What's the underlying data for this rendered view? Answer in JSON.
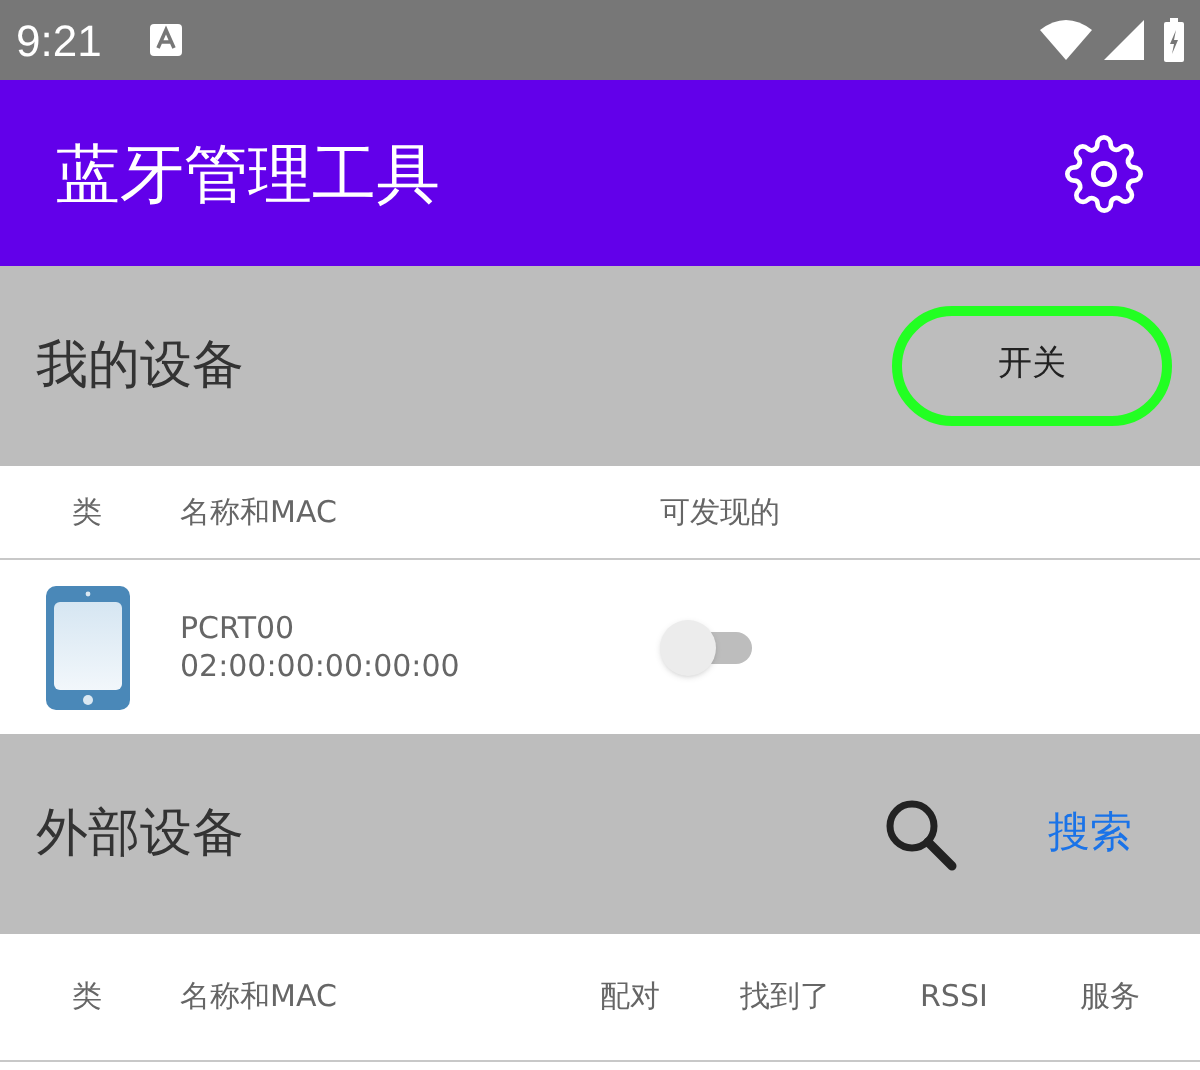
{
  "status_bar": {
    "time": "9:21"
  },
  "app_bar": {
    "title": "蓝牙管理工具"
  },
  "my_devices": {
    "title": "我的设备",
    "button": "开关",
    "columns": [
      "类",
      "名称和MAC",
      "可发现的"
    ],
    "rows": [
      {
        "name": "PCRT00",
        "mac": "02:00:00:00:00:00",
        "discoverable": false
      }
    ]
  },
  "external_devices": {
    "title": "外部设备",
    "search_button": "搜索",
    "columns": [
      "类",
      "名称和MAC",
      "配对",
      "找到了",
      "RSSI",
      "服务"
    ]
  }
}
